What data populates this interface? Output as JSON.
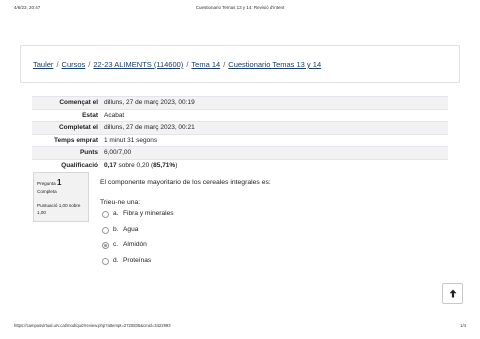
{
  "print_header": {
    "date": "4/6/23, 20:47",
    "title": "Cuestionario Temas 13 y 14: Revisió d'intent"
  },
  "breadcrumb": [
    {
      "label": "Tauler"
    },
    {
      "label": "Cursos"
    },
    {
      "label": "22-23 ALIMENTS (114600)"
    },
    {
      "label": "Tema 14"
    },
    {
      "label": "Cuestionario Temas 13 y 14"
    }
  ],
  "summary": [
    {
      "key": "Començat el",
      "value": "dilluns, 27 de març 2023, 00:19"
    },
    {
      "key": "Estat",
      "value": "Acabat"
    },
    {
      "key": "Completat el",
      "value": "dilluns, 27 de març 2023, 00:21"
    },
    {
      "key": "Temps emprat",
      "value": "1 minut 31 segons"
    },
    {
      "key": "Punts",
      "value": "6,00/7,00"
    },
    {
      "key": "Qualificació",
      "value_bold": "0,17",
      "value_rest": " sobre 0,20 (",
      "value_pct": "85,71%",
      "value_end": ")"
    }
  ],
  "question_info": {
    "prefix": "Pregunta",
    "number": "1",
    "state": "Completa",
    "grade": "Puntuació 1,00 sobre 1,00"
  },
  "question": {
    "text": "El componente mayoritario de los cereales integrales es:",
    "prompt": "Trieu-ne una:",
    "options": [
      {
        "letter": "a.",
        "text": "Fibra y minerales",
        "selected": false
      },
      {
        "letter": "b.",
        "text": "Agua",
        "selected": false
      },
      {
        "letter": "c.",
        "text": "Almidón",
        "selected": true
      },
      {
        "letter": "d.",
        "text": "Proteínas",
        "selected": false
      }
    ]
  },
  "print_footer": {
    "url": "https://campusvirtual.urv.cat/mod/quiz/review.php?attempt=2720835&cmid=3422993",
    "pages": "1/4"
  },
  "icons": {
    "top_button": "arrow-up-icon"
  }
}
